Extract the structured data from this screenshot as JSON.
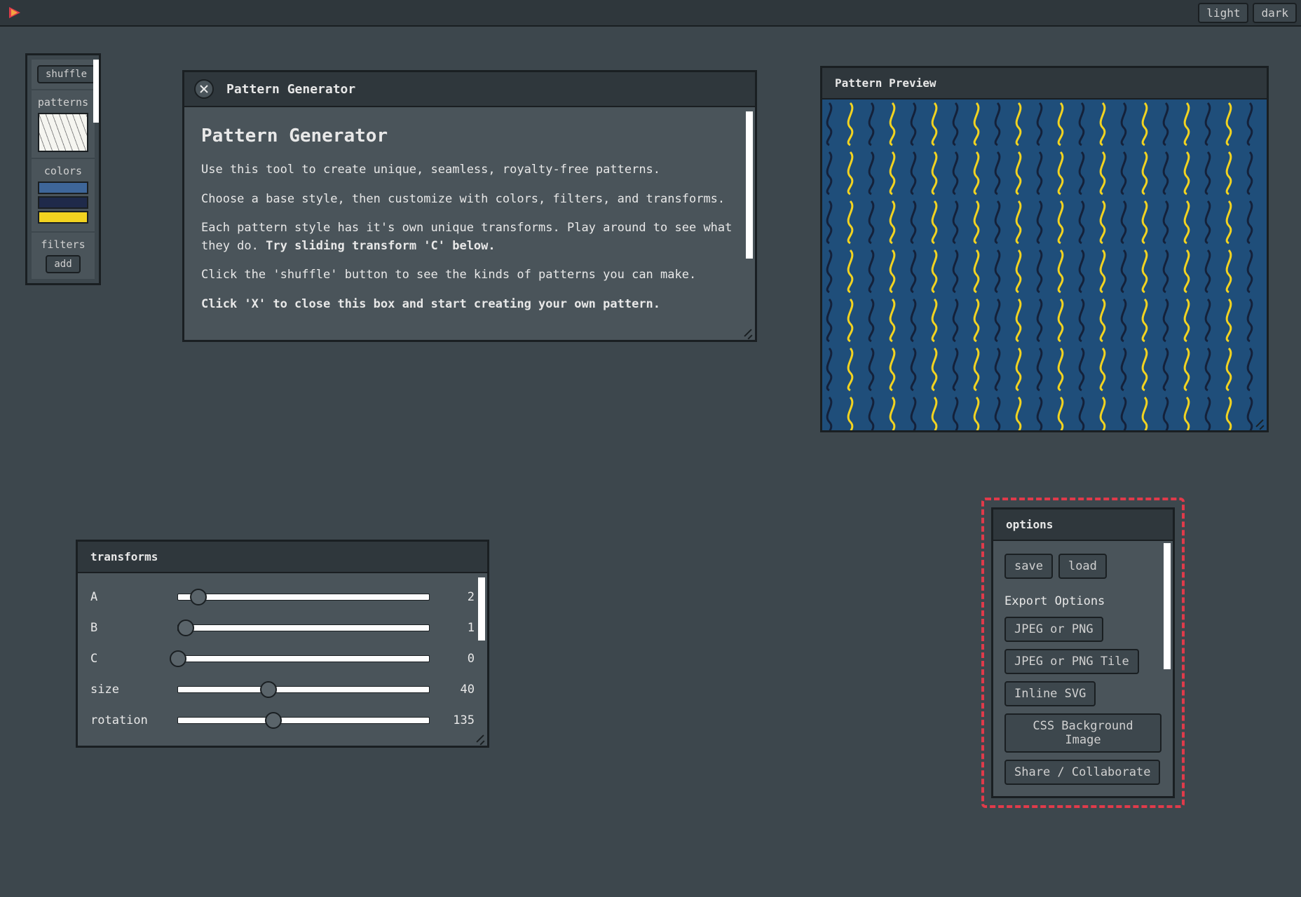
{
  "topbar": {
    "theme_light": "light",
    "theme_dark": "dark"
  },
  "sidebar": {
    "shuffle_label": "shuffle",
    "patterns_label": "patterns",
    "colors_label": "colors",
    "filters_label": "filters",
    "add_label": "add",
    "colors": [
      "#3e6699",
      "#1f2a4a",
      "#f2d320"
    ]
  },
  "intro": {
    "header_title": "Pattern Generator",
    "body_title": "Pattern Generator",
    "p1": "Use this tool to create unique, seamless, royalty-free patterns.",
    "p2": "Choose a base style, then customize with colors, filters, and transforms.",
    "p3a": "Each pattern style has it's own unique transforms. Play around to see what they do. ",
    "p3b": "Try sliding transform 'C' below.",
    "p4": "Click the 'shuffle' button to see the kinds of patterns you can make.",
    "p5": "Click 'X' to close this box and start creating your own pattern."
  },
  "preview": {
    "title": "Pattern Preview",
    "bg_color": "#1f4e7a",
    "wave_colors": [
      "#14213a",
      "#f2d320"
    ]
  },
  "transforms": {
    "title": "transforms",
    "rows": [
      {
        "label": "A",
        "value": 2,
        "pos": 8
      },
      {
        "label": "B",
        "value": 1,
        "pos": 3
      },
      {
        "label": "C",
        "value": 0,
        "pos": 0
      },
      {
        "label": "size",
        "value": 40,
        "pos": 36
      },
      {
        "label": "rotation",
        "value": 135,
        "pos": 38
      }
    ]
  },
  "options": {
    "title": "options",
    "save": "save",
    "load": "load",
    "export_label": "Export Options",
    "exports": [
      "JPEG or PNG",
      "JPEG or PNG Tile",
      "Inline SVG",
      "CSS Background Image",
      "Share / Collaborate"
    ]
  }
}
